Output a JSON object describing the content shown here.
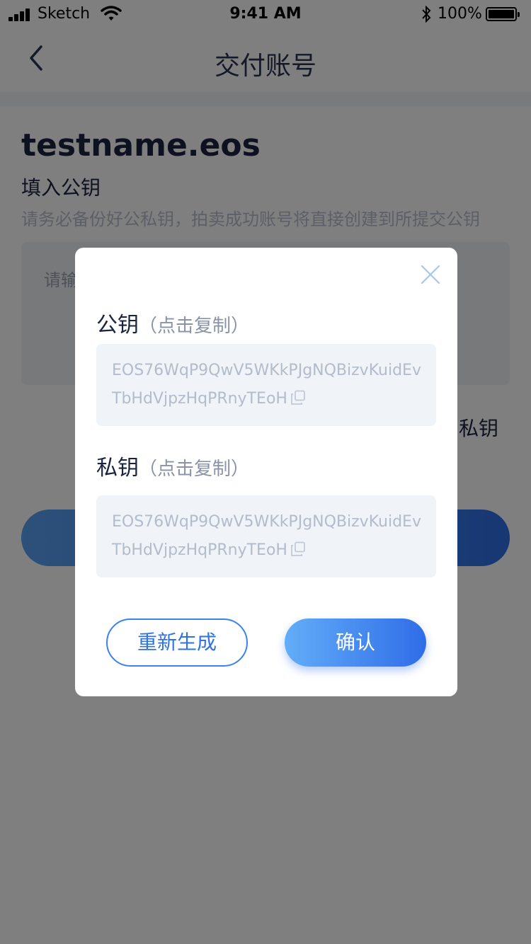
{
  "status_bar": {
    "carrier": "Sketch",
    "time": "9:41 AM",
    "battery_percent": "100%"
  },
  "nav": {
    "title": "交付账号",
    "back_icon": "chevron-left-icon"
  },
  "page": {
    "account_name": "testname.eos",
    "section_title": "填入公钥",
    "hint": "请务必备份好公私钥，拍卖成功账号将直接创建到所提交公钥",
    "input_placeholder": "请输",
    "generate_link": "私钥"
  },
  "dialog": {
    "public_key": {
      "title": "公钥",
      "sub": "（点击复制）",
      "value": "EOS76WqP9QwV5WKkPJgNQBizvKuidEvTbHdVjpzHqPRnyTEoH"
    },
    "private_key": {
      "title": "私钥",
      "sub": "（点击复制）",
      "value": "EOS76WqP9QwV5WKkPJgNQBizvKuidEvTbHdVjpzHqPRnyTEoH"
    },
    "regenerate_label": "重新生成",
    "confirm_label": "确认"
  },
  "colors": {
    "accent": "#2f6de8",
    "overlay": "rgba(0,0,0,0.5)"
  }
}
